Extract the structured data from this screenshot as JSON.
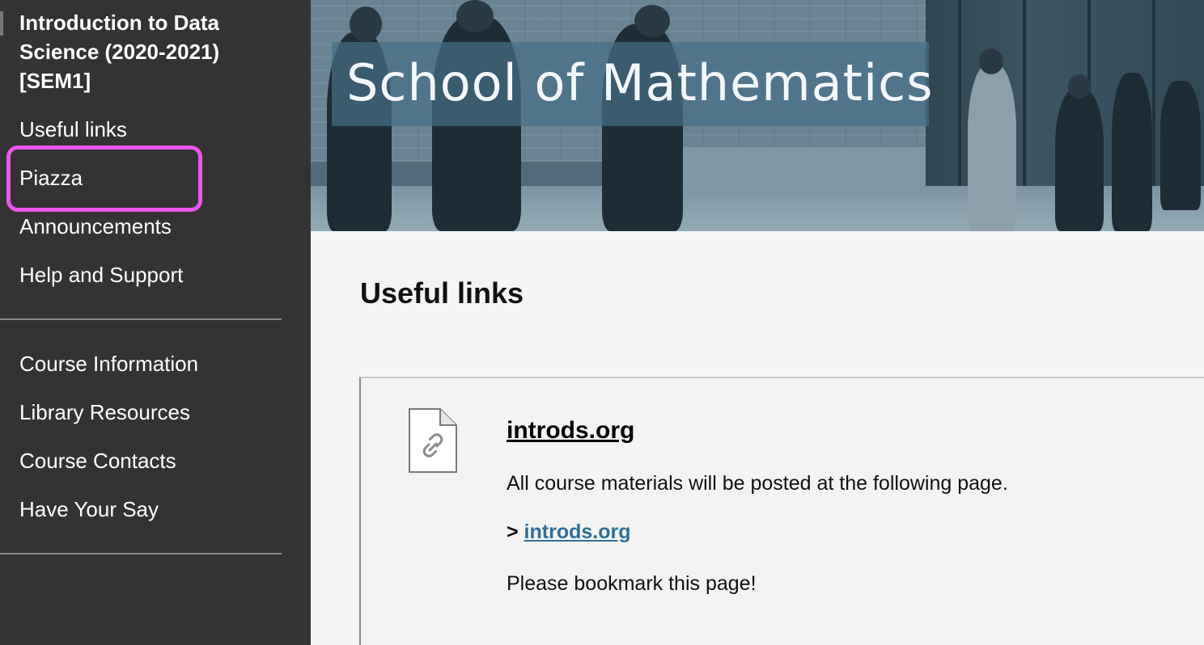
{
  "sidebar": {
    "course_title": "Introduction to Data Science (2020-2021) [SEM1]",
    "primary_items": [
      {
        "label": "Useful links"
      },
      {
        "label": "Piazza"
      },
      {
        "label": "Announcements"
      },
      {
        "label": "Help and Support"
      }
    ],
    "secondary_items": [
      {
        "label": "Course Information"
      },
      {
        "label": "Library Resources"
      },
      {
        "label": "Course Contacts"
      },
      {
        "label": "Have Your Say"
      }
    ],
    "highlighted_item": "Piazza",
    "highlight_color": "#ee55ee",
    "background_color": "#333333"
  },
  "banner": {
    "title": "School of Mathematics"
  },
  "main": {
    "heading": "Useful links",
    "items": [
      {
        "icon": "link-file-icon",
        "title": "introds.org",
        "description": "All course materials will be posted at the following page.",
        "link_prefix": "> ",
        "link_text": "introds.org",
        "note": "Please bookmark this page!"
      }
    ],
    "link_color": "#2f6f9a"
  }
}
